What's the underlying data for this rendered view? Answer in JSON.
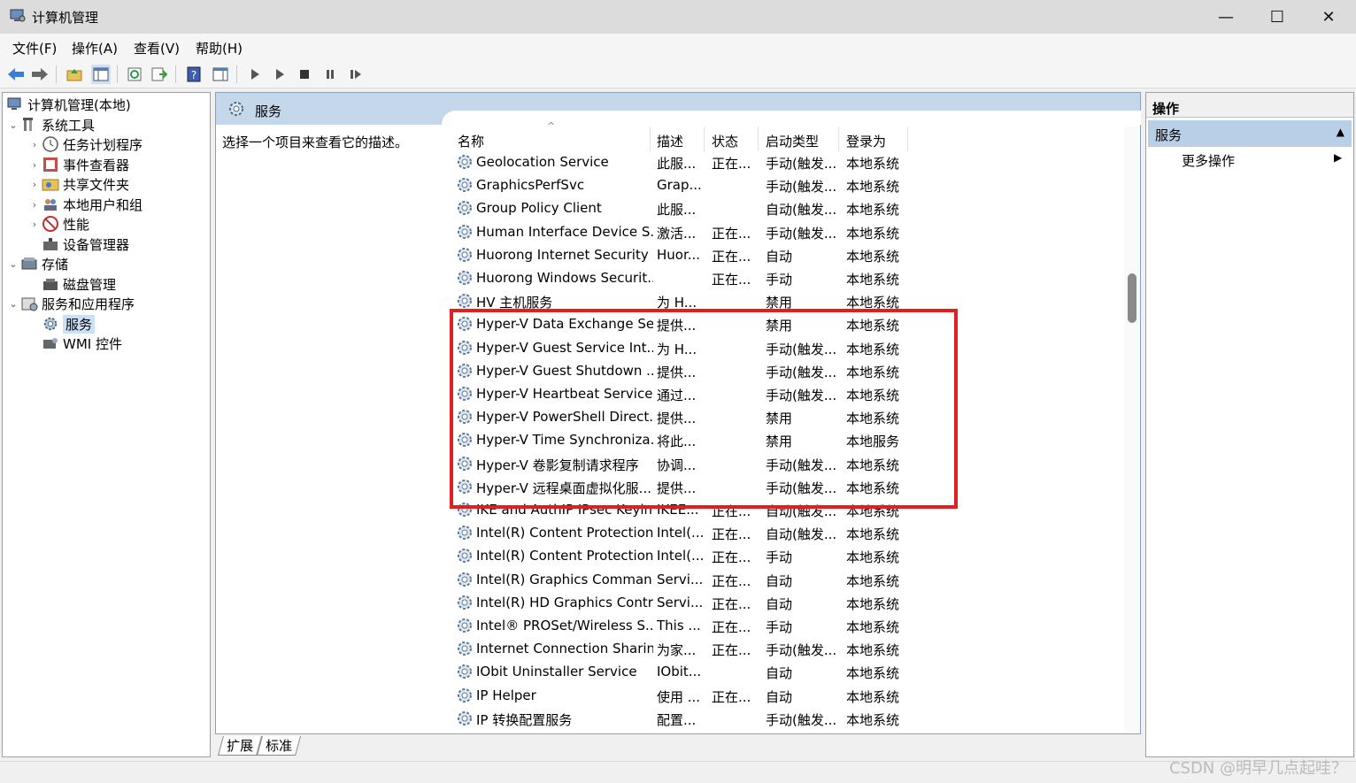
{
  "window": {
    "title": "计算机管理",
    "minimize_glyph": "—",
    "maximize_glyph": "☐",
    "close_glyph": "✕"
  },
  "menu": [
    "文件(F)",
    "操作(A)",
    "查看(V)",
    "帮助(H)"
  ],
  "toolbar": {
    "icons": [
      "back-arrow-icon",
      "forward-arrow-icon",
      "up-folder-icon",
      "show-hide-tree-icon",
      "refresh-icon",
      "export-list-icon",
      "help-icon",
      "show-hide-action-icon",
      "start-service-icon",
      "start-service-alt-icon",
      "stop-service-icon",
      "pause-service-icon",
      "restart-service-icon"
    ]
  },
  "tree": {
    "root": "计算机管理(本地)",
    "system_tools": "系统工具",
    "task_scheduler": "任务计划程序",
    "event_viewer": "事件查看器",
    "shared_folders": "共享文件夹",
    "local_users": "本地用户和组",
    "performance": "性能",
    "device_manager": "设备管理器",
    "storage": "存储",
    "disk_management": "磁盘管理",
    "services_apps": "服务和应用程序",
    "services": "服务",
    "wmi": "WMI 控件"
  },
  "center": {
    "header_title": "服务",
    "description_prompt": "选择一个项目来查看它的描述。",
    "columns": {
      "name": "名称",
      "desc": "描述",
      "status": "状态",
      "startup": "启动类型",
      "logon": "登录为"
    },
    "sort_indicator": "^",
    "rows": [
      {
        "name": "Geolocation Service",
        "desc": "此服...",
        "status": "正在...",
        "startup": "手动(触发...",
        "logon": "本地系统"
      },
      {
        "name": "GraphicsPerfSvc",
        "desc": "Grap...",
        "status": "",
        "startup": "手动(触发...",
        "logon": "本地系统"
      },
      {
        "name": "Group Policy Client",
        "desc": "此服...",
        "status": "",
        "startup": "自动(触发...",
        "logon": "本地系统"
      },
      {
        "name": "Human Interface Device S...",
        "desc": "激活...",
        "status": "正在...",
        "startup": "手动(触发...",
        "logon": "本地系统"
      },
      {
        "name": "Huorong Internet Security ...",
        "desc": "Huor...",
        "status": "正在...",
        "startup": "自动",
        "logon": "本地系统"
      },
      {
        "name": "Huorong Windows Securit...",
        "desc": "",
        "status": "正在...",
        "startup": "手动",
        "logon": "本地系统"
      },
      {
        "name": "HV 主机服务",
        "desc": "为 H...",
        "status": "",
        "startup": "禁用",
        "logon": "本地系统"
      },
      {
        "name": "Hyper-V Data Exchange Se...",
        "desc": "提供...",
        "status": "",
        "startup": "禁用",
        "logon": "本地系统"
      },
      {
        "name": "Hyper-V Guest Service Int...",
        "desc": "为 H...",
        "status": "",
        "startup": "手动(触发...",
        "logon": "本地系统"
      },
      {
        "name": "Hyper-V Guest Shutdown ...",
        "desc": "提供...",
        "status": "",
        "startup": "手动(触发...",
        "logon": "本地系统"
      },
      {
        "name": "Hyper-V Heartbeat Service",
        "desc": "通过...",
        "status": "",
        "startup": "手动(触发...",
        "logon": "本地系统"
      },
      {
        "name": "Hyper-V PowerShell Direct...",
        "desc": "提供...",
        "status": "",
        "startup": "禁用",
        "logon": "本地系统"
      },
      {
        "name": "Hyper-V Time Synchroniza...",
        "desc": "将此...",
        "status": "",
        "startup": "禁用",
        "logon": "本地服务"
      },
      {
        "name": "Hyper-V 卷影复制请求程序",
        "desc": "协调...",
        "status": "",
        "startup": "手动(触发...",
        "logon": "本地系统"
      },
      {
        "name": "Hyper-V 远程桌面虚拟化服...",
        "desc": "提供...",
        "status": "",
        "startup": "手动(触发...",
        "logon": "本地系统"
      },
      {
        "name": "IKE and AuthIP IPsec Keyin...",
        "desc": "IKEE...",
        "status": "正在...",
        "startup": "自动(触发...",
        "logon": "本地系统"
      },
      {
        "name": "Intel(R) Content Protection...",
        "desc": "Intel(...",
        "status": "正在...",
        "startup": "自动(触发...",
        "logon": "本地系统"
      },
      {
        "name": "Intel(R) Content Protection...",
        "desc": "Intel(...",
        "status": "正在...",
        "startup": "手动",
        "logon": "本地系统"
      },
      {
        "name": "Intel(R) Graphics Comman...",
        "desc": "Servi...",
        "status": "正在...",
        "startup": "自动",
        "logon": "本地系统"
      },
      {
        "name": "Intel(R) HD Graphics Contr...",
        "desc": "Servi...",
        "status": "正在...",
        "startup": "自动",
        "logon": "本地系统"
      },
      {
        "name": "Intel® PROSet/Wireless S...",
        "desc": "This ...",
        "status": "正在...",
        "startup": "手动",
        "logon": "本地系统"
      },
      {
        "name": "Internet Connection Sharin...",
        "desc": "为家...",
        "status": "正在...",
        "startup": "手动(触发...",
        "logon": "本地系统"
      },
      {
        "name": "IObit Uninstaller Service",
        "desc": "IObit...",
        "status": "",
        "startup": "自动",
        "logon": "本地系统"
      },
      {
        "name": "IP Helper",
        "desc": "使用 ...",
        "status": "正在...",
        "startup": "自动",
        "logon": "本地系统"
      },
      {
        "name": "IP 转换配置服务",
        "desc": "配置...",
        "status": "",
        "startup": "手动(触发...",
        "logon": "本地系统"
      }
    ],
    "tabs": [
      "扩展",
      "标准"
    ]
  },
  "actions": {
    "title": "操作",
    "section": "服务",
    "section_arrow": "▲",
    "more": "更多操作",
    "more_arrow": "▶"
  },
  "watermark": "CSDN @明早几点起哇？",
  "colors": {
    "highlight": "#e02020",
    "header_band": "#c5d7ea",
    "selection": "#cce0f5"
  }
}
